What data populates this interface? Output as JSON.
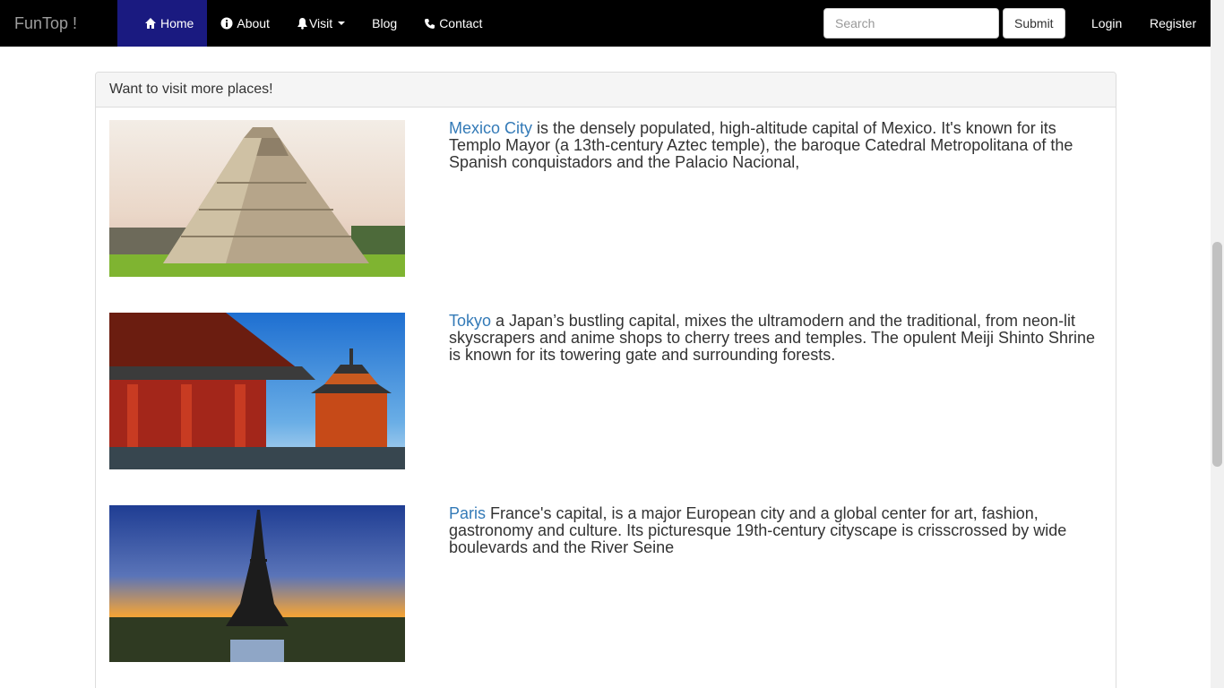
{
  "navbar": {
    "brand": "FunTop !",
    "items": [
      {
        "label": "Home",
        "icon": "home-icon"
      },
      {
        "label": "About",
        "icon": "info-icon"
      },
      {
        "label": "Visit",
        "icon": "bell-icon",
        "dropdown": true
      },
      {
        "label": "Blog"
      },
      {
        "label": "Contact",
        "icon": "phone-icon"
      }
    ],
    "search_placeholder": "Search",
    "search_value": "",
    "submit_label": "Submit",
    "login_label": "Login",
    "register_label": "Register",
    "active_color": "#1a1a80"
  },
  "panel": {
    "heading": "Want to visit more places!",
    "places": [
      {
        "name": "Mexico City",
        "description": " is the densely populated, high-altitude capital of Mexico. It's known for its Templo Mayor (a 13th-century Aztec temple), the baroque Catedral Metropolitana of the Spanish conquistadors and the Palacio Nacional,",
        "image": "mexico-pyramid-image"
      },
      {
        "name": "Tokyo",
        "description": " a Japan’s bustling capital, mixes the ultramodern and the traditional, from neon-lit skyscrapers and anime shops to cherry trees and temples. The opulent Meiji Shinto Shrine is known for its towering gate and surrounding forests.",
        "image": "tokyo-temple-image"
      },
      {
        "name": "Paris",
        "description": " France's capital, is a major European city and a global center for art, fashion, gastronomy and culture. Its picturesque 19th-century cityscape is crisscrossed by wide boulevards and the River Seine",
        "image": "paris-eiffel-image"
      }
    ]
  },
  "colors": {
    "link": "#337ab7",
    "navbar_bg": "#000000"
  }
}
